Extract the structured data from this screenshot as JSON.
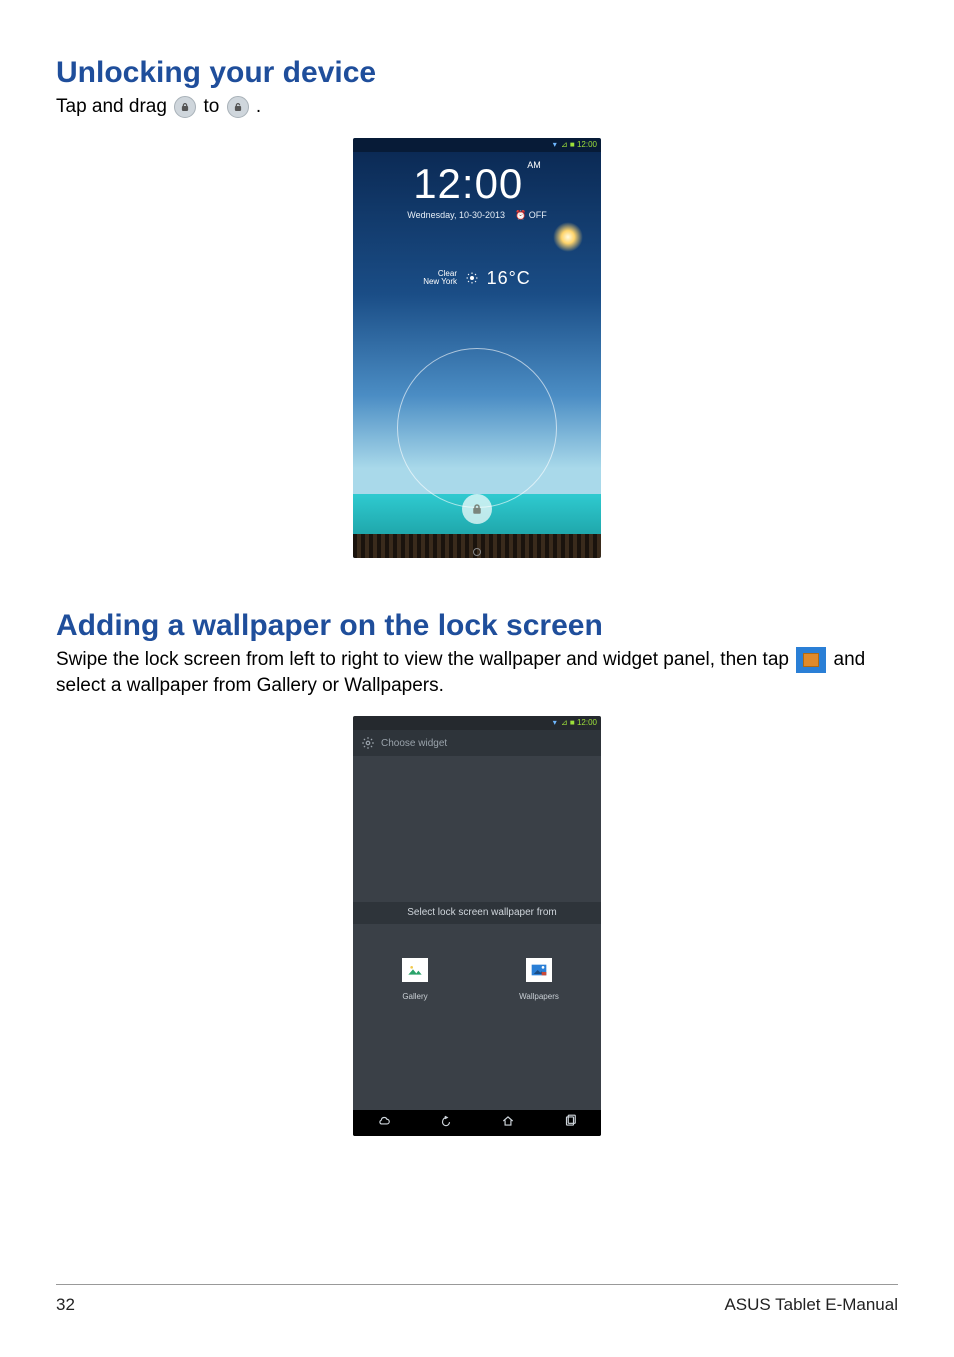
{
  "headings": {
    "unlock": "Unlocking your device",
    "wallpaper": "Adding a wallpaper on the lock screen"
  },
  "instructions": {
    "unlock_pre": "Tap and drag ",
    "unlock_mid": " to ",
    "unlock_post": ".",
    "wallpaper_pre": "Swipe the lock screen from left to right to view the wallpaper and widget panel, then tap ",
    "wallpaper_post": " and select a wallpaper from Gallery or Wallpapers."
  },
  "lockscreen": {
    "status_time": "12:00",
    "clock_time": "12:00",
    "clock_ampm": "AM",
    "date": "Wednesday, 10-30-2013",
    "alarm": "⏰ OFF",
    "weather_condition": "Clear",
    "weather_city": "New York",
    "weather_temp": "16°C"
  },
  "wallpaper_panel": {
    "status_time": "12:00",
    "choose_widget": "Choose widget",
    "select_label": "Select lock screen wallpaper from",
    "option_gallery": "Gallery",
    "option_wallpapers": "Wallpapers"
  },
  "footer": {
    "page": "32",
    "book": "ASUS Tablet E-Manual"
  }
}
